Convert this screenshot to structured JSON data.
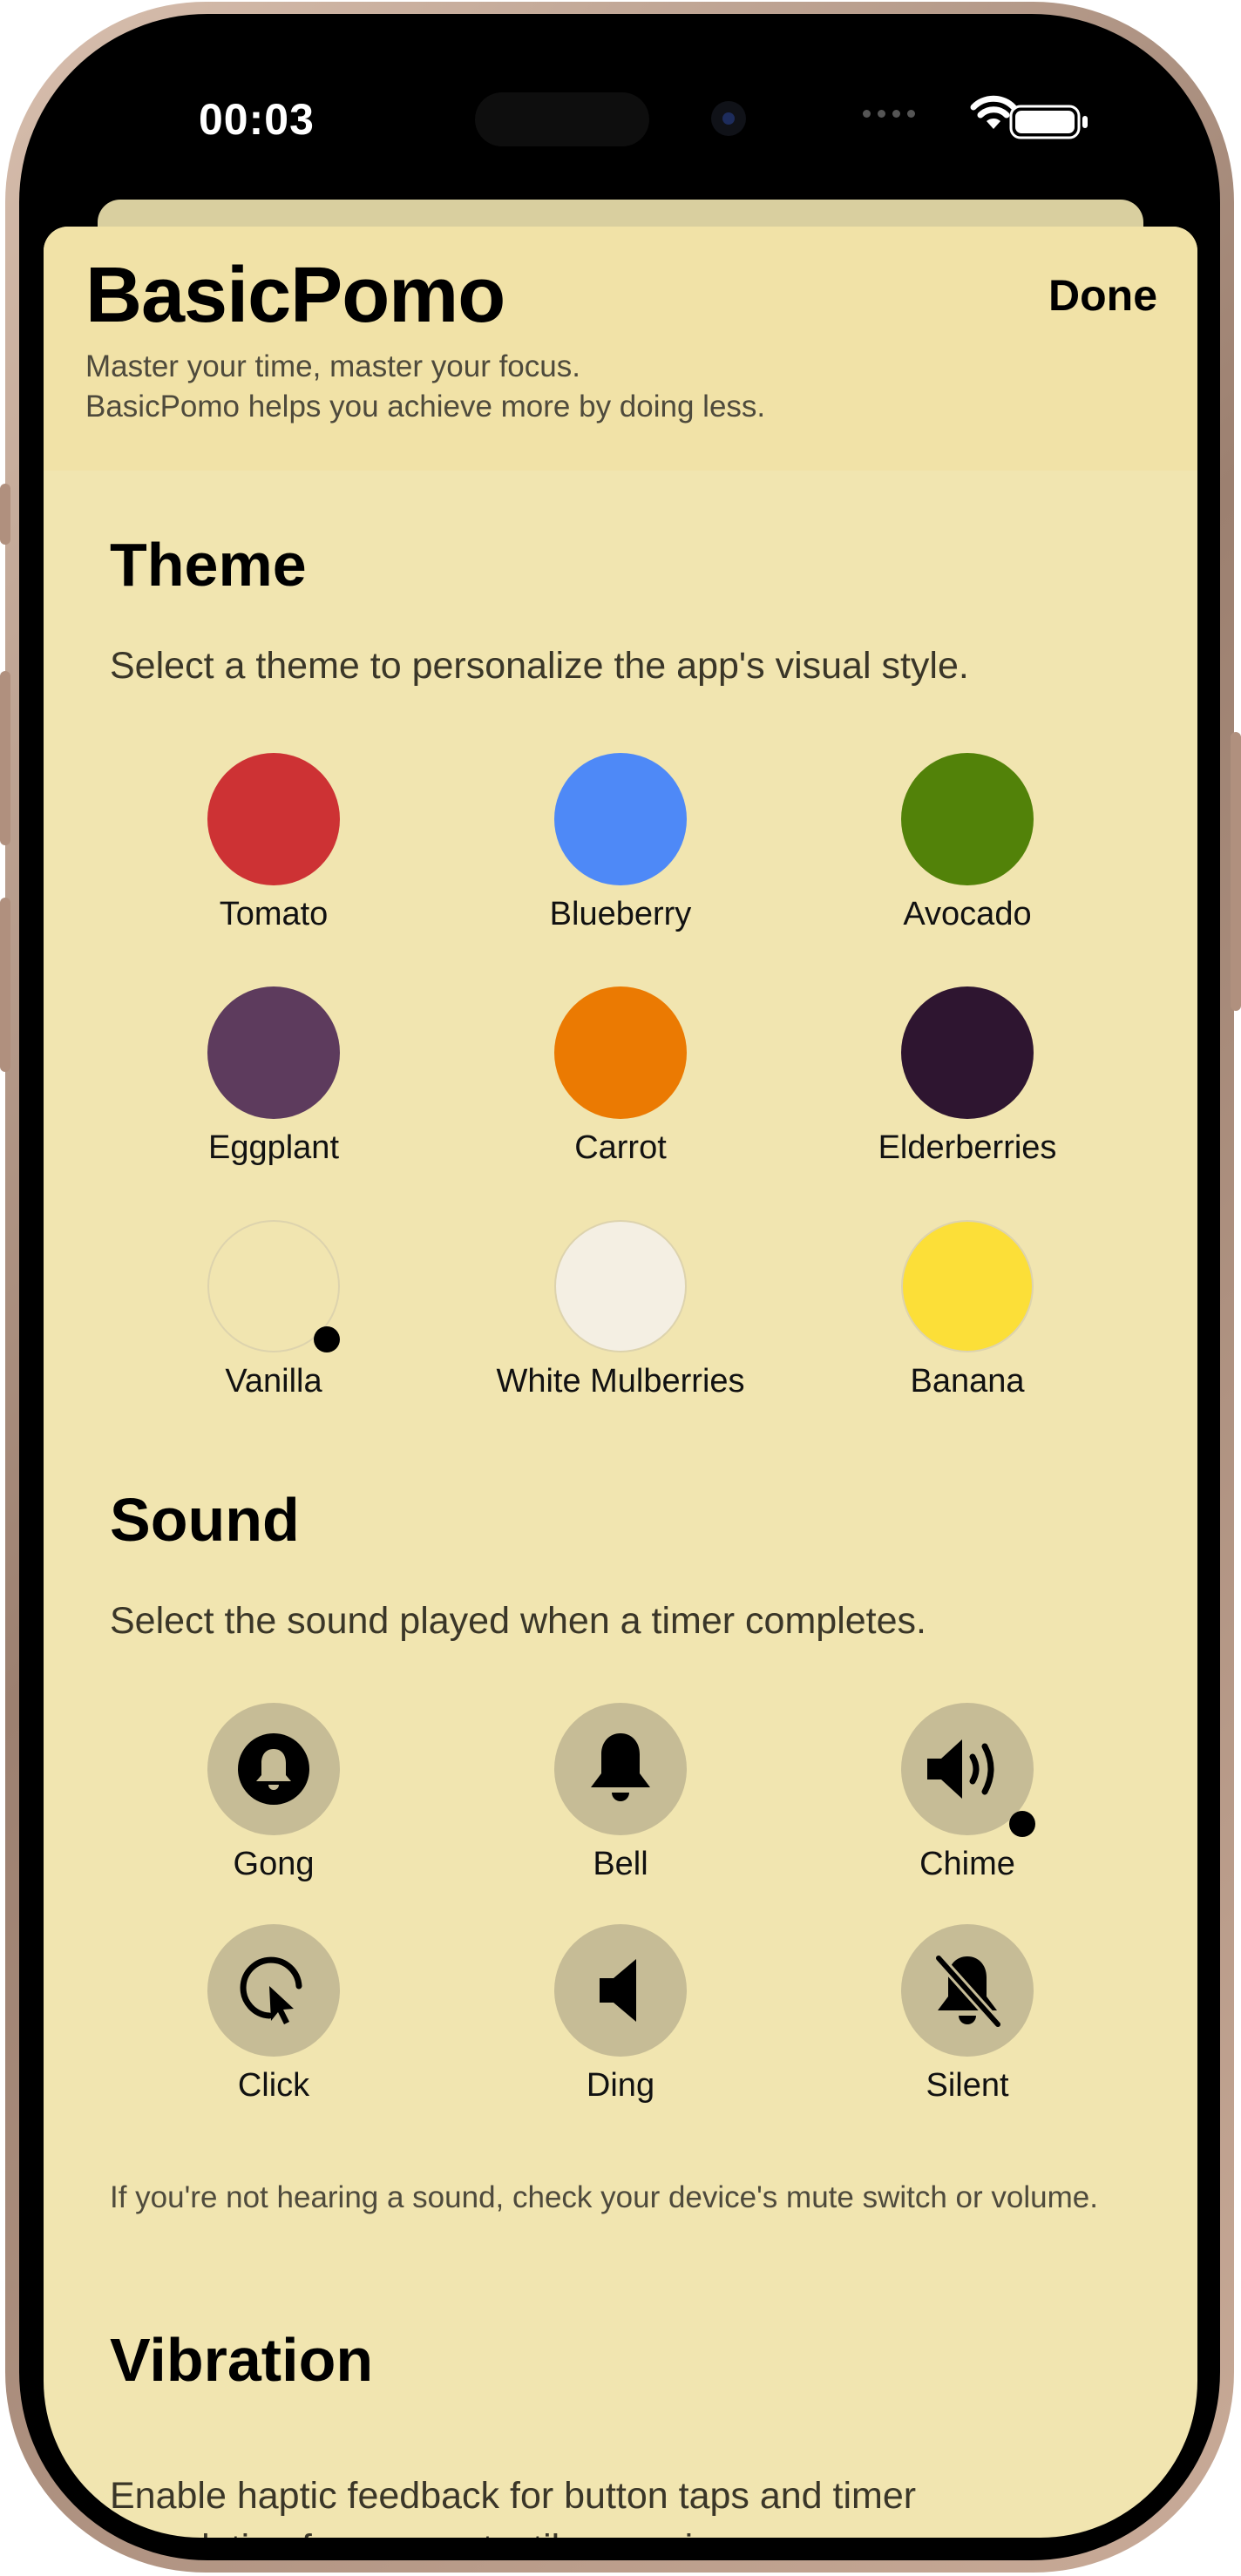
{
  "status": {
    "time": "00:03"
  },
  "header": {
    "title": "BasicPomo",
    "done_label": "Done",
    "tagline_line1": "Master your time, master your focus.",
    "tagline_line2": "BasicPomo helps you achieve more by doing less."
  },
  "theme": {
    "title": "Theme",
    "description": "Select a theme to personalize the app's visual style.",
    "selected": "Vanilla",
    "options": [
      {
        "label": "Tomato",
        "color": "#cd3234"
      },
      {
        "label": "Blueberry",
        "color": "#4e89f7"
      },
      {
        "label": "Avocado",
        "color": "#528209"
      },
      {
        "label": "Eggplant",
        "color": "#5d3b5d"
      },
      {
        "label": "Carrot",
        "color": "#eb7a02"
      },
      {
        "label": "Elderberries",
        "color": "#2e1530"
      },
      {
        "label": "Vanilla",
        "color": "#f1e5b0"
      },
      {
        "label": "White Mulberries",
        "color": "#f4efe3"
      },
      {
        "label": "Banana",
        "color": "#fcdf38"
      }
    ]
  },
  "sound": {
    "title": "Sound",
    "description": "Select the sound played when a timer completes.",
    "selected": "Chime",
    "options": [
      {
        "label": "Gong",
        "icon": "gong-icon"
      },
      {
        "label": "Bell",
        "icon": "bell-icon"
      },
      {
        "label": "Chime",
        "icon": "speaker-wave-icon"
      },
      {
        "label": "Click",
        "icon": "click-icon"
      },
      {
        "label": "Ding",
        "icon": "speaker-icon"
      },
      {
        "label": "Silent",
        "icon": "bell-slash-icon"
      }
    ],
    "note": "If you're not hearing a sound, check your device's mute switch or volume."
  },
  "vibration": {
    "title": "Vibration",
    "description": "Enable haptic feedback for button taps and timer completion for a more tactile experience."
  }
}
